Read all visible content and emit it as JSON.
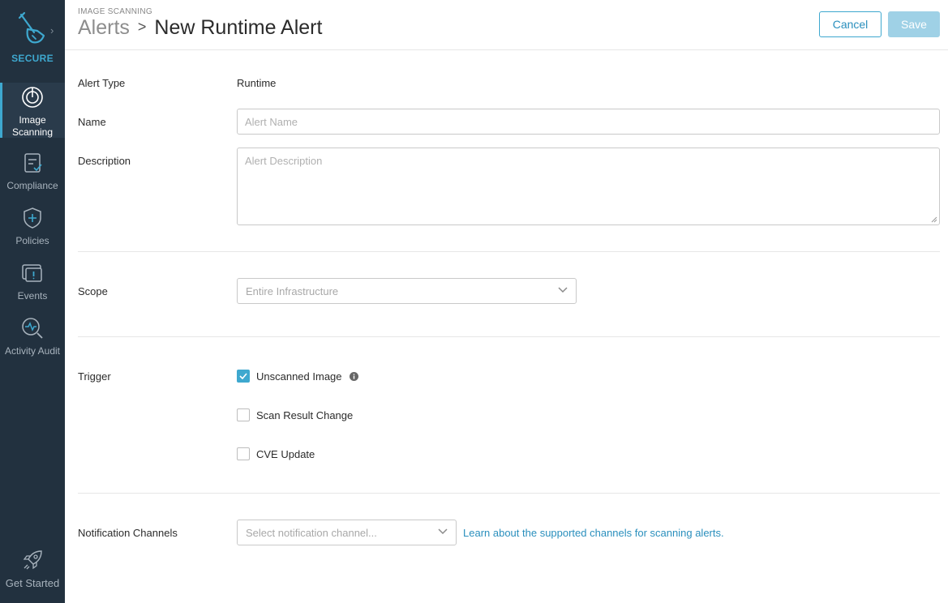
{
  "sidebar": {
    "brand_label": "SECURE",
    "items": [
      {
        "label": "Image Scanning",
        "icon": "image-scanning-icon",
        "active": true
      },
      {
        "label": "Compliance",
        "icon": "compliance-icon"
      },
      {
        "label": "Policies",
        "icon": "policies-icon"
      },
      {
        "label": "Events",
        "icon": "events-icon"
      },
      {
        "label": "Activity Audit",
        "icon": "activity-audit-icon"
      }
    ],
    "get_started": "Get Started"
  },
  "header": {
    "section": "IMAGE SCANNING",
    "breadcrumb_parent": "Alerts",
    "breadcrumb_separator": ">",
    "title": "New Runtime Alert",
    "cancel_label": "Cancel",
    "save_label": "Save"
  },
  "form": {
    "alert_type_label": "Alert Type",
    "alert_type_value": "Runtime",
    "name_label": "Name",
    "name_placeholder": "Alert Name",
    "description_label": "Description",
    "description_placeholder": "Alert Description",
    "scope_label": "Scope",
    "scope_value": "Entire Infrastructure",
    "trigger_label": "Trigger",
    "triggers": [
      {
        "label": "Unscanned Image",
        "checked": true,
        "has_info": true
      },
      {
        "label": "Scan Result Change",
        "checked": false
      },
      {
        "label": "CVE Update",
        "checked": false
      }
    ],
    "notification_label": "Notification Channels",
    "notification_placeholder": "Select notification channel...",
    "notification_link": "Learn about the supported channels for scanning alerts."
  },
  "colors": {
    "sidebar_bg": "#22313f",
    "accent": "#3ea8cf",
    "save_disabled": "#9fd1e6"
  }
}
